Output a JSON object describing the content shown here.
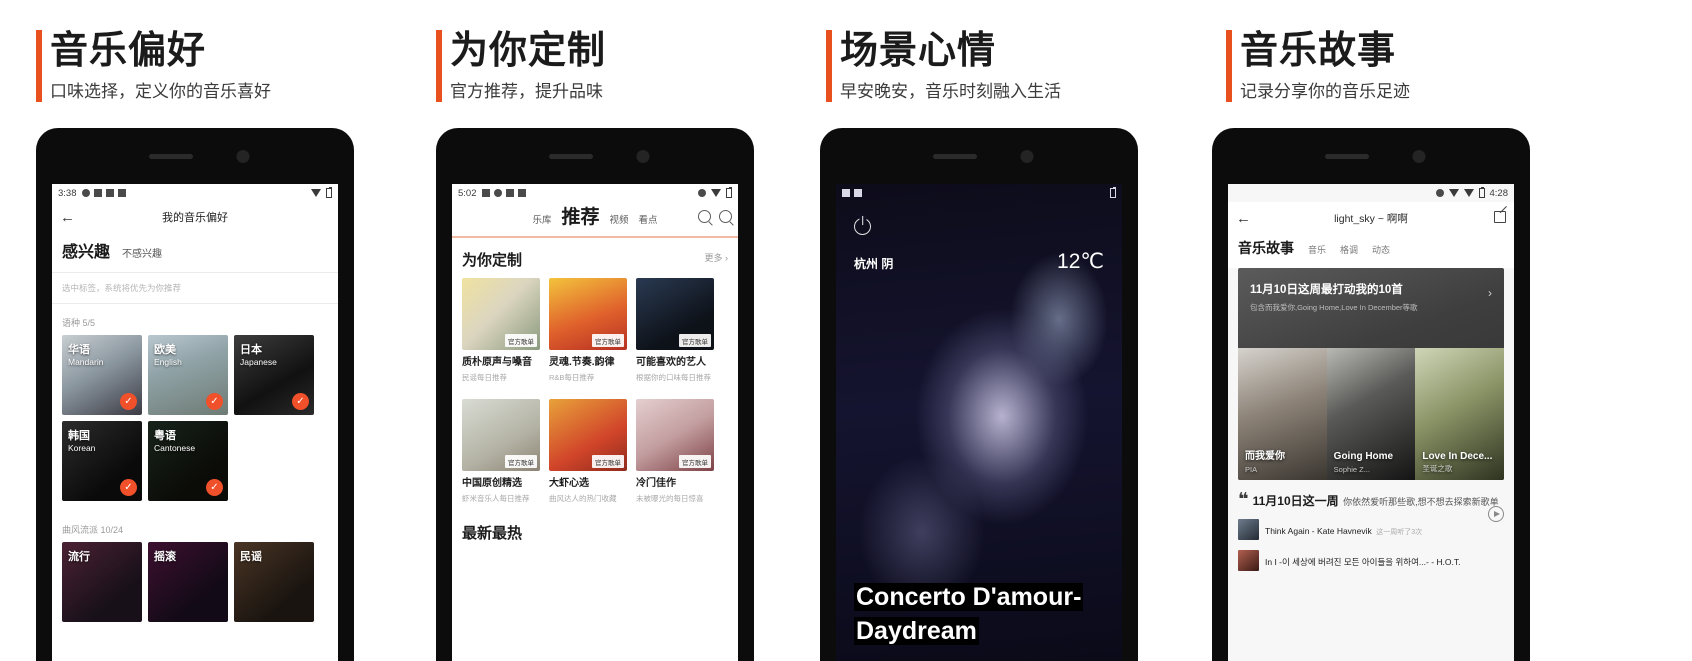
{
  "accent_color": "#e8501d",
  "panels": [
    {
      "heading": "音乐偏好",
      "subheading": "口味选择，定义你的音乐喜好",
      "status": {
        "clock": "3:38"
      },
      "nav": {
        "back": "←",
        "title": "我的音乐偏好"
      },
      "tabs": {
        "active": "感兴趣",
        "inactive": "不感兴趣"
      },
      "hint": "选中标签，系统将优先为你推荐",
      "sections": [
        {
          "label": "语种",
          "count": "5/5",
          "tiles": [
            {
              "cn": "华语",
              "en": "Mandarin",
              "selected": "✓"
            },
            {
              "cn": "欧美",
              "en": "English",
              "selected": "✓"
            },
            {
              "cn": "日本",
              "en": "Japanese",
              "selected": "✓"
            },
            {
              "cn": "韩国",
              "en": "Korean",
              "selected": "✓"
            },
            {
              "cn": "粤语",
              "en": "Cantonese",
              "selected": "✓"
            }
          ]
        },
        {
          "label": "曲风流派",
          "count": "10/24",
          "tiles": [
            {
              "cn": "流行",
              "en": "",
              "selected": ""
            },
            {
              "cn": "摇滚",
              "en": "",
              "selected": ""
            },
            {
              "cn": "民谣",
              "en": "",
              "selected": ""
            }
          ]
        }
      ]
    },
    {
      "heading": "为你定制",
      "subheading": "官方推荐，提升品味",
      "status": {
        "clock": "5:02"
      },
      "nav_tabs": [
        "乐库",
        "推荐",
        "视频",
        "看点"
      ],
      "nav_active": "推荐",
      "section_title": "为你定制",
      "more_label": "更多 ›",
      "cards": [
        {
          "title": "质朴原声与嗓音",
          "sub": "民谣每日推荐",
          "badge": "官方歌单"
        },
        {
          "title": "灵魂.节奏.韵律",
          "sub": "R&B每日推荐",
          "badge": "官方歌单"
        },
        {
          "title": "可能喜欢的艺人",
          "sub": "根据你的口味每日推荐",
          "badge": "官方歌单"
        },
        {
          "title": "中国原创精选",
          "sub": "虾米音乐人每日推荐",
          "badge": "官方歌单"
        },
        {
          "title": "大虾心选",
          "sub": "曲风达人的热门收藏",
          "badge": "官方歌单"
        },
        {
          "title": "冷门佳作",
          "sub": "未被曝光的每日惊喜",
          "badge": "官方歌单"
        }
      ],
      "next_section": "最新最热"
    },
    {
      "heading": "场景心情",
      "subheading": "早安晚安，音乐时刻融入生活",
      "weather": {
        "city": "杭州 阴",
        "temp": "12℃"
      },
      "now_playing": "Concerto D'amour-Daydream"
    },
    {
      "heading": "音乐故事",
      "subheading": "记录分享你的音乐足迹",
      "status": {
        "clock": "4:28"
      },
      "nav": {
        "back": "←",
        "title": "light_sky ~ 啊啊"
      },
      "tabs": {
        "active": "音乐故事",
        "others": [
          "音乐",
          "格调",
          "动态"
        ]
      },
      "story": {
        "title": "11月10日这周最打动我的10首",
        "sub": "包含而我爱你,Going Home,Love In December等歌",
        "chevron": "›",
        "covers": [
          {
            "name": "而我爱你",
            "artist": "PIA"
          },
          {
            "name": "Going Home",
            "artist": "Sophie Z..."
          },
          {
            "name": "Love In Dece...",
            "artist": "圣诞之歌"
          }
        ]
      },
      "quote": {
        "mark": "❝",
        "strong": "11月10日这一周",
        "rest": "你依然爱听那些歌,想不想去探索新歌单"
      },
      "songs": [
        {
          "title": "Think Again - Kate Havnevik",
          "sub": "这一周听了3次"
        },
        {
          "title": "In I -이 세상에 버려진 모든 아이들을 위하여...- - H.O.T.",
          "sub": ""
        }
      ]
    }
  ]
}
